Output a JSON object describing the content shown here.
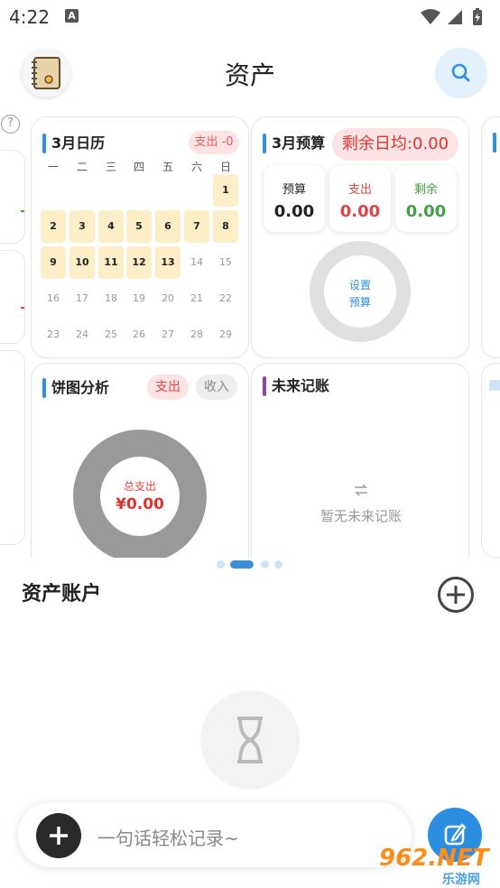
{
  "status": {
    "time": "4:22",
    "notif_icon": "A"
  },
  "header": {
    "title": "资产"
  },
  "calendar": {
    "title": "3月日历",
    "spend_badge": "支出 -0",
    "weekdays": [
      "一",
      "二",
      "三",
      "四",
      "五",
      "六",
      "日"
    ],
    "weeks": [
      [
        "",
        "",
        "",
        "",
        "",
        "",
        "1"
      ],
      [
        "2",
        "3",
        "4",
        "5",
        "6",
        "7",
        "8"
      ],
      [
        "9",
        "10",
        "11",
        "12",
        "13",
        "14",
        "15"
      ],
      [
        "16",
        "17",
        "18",
        "19",
        "20",
        "21",
        "22"
      ],
      [
        "23",
        "24",
        "25",
        "26",
        "27",
        "28",
        "29"
      ]
    ],
    "highlighted_days": [
      "1",
      "2",
      "3",
      "4",
      "5",
      "6",
      "7",
      "8",
      "9",
      "10",
      "11",
      "12",
      "13"
    ]
  },
  "budget": {
    "title": "3月预算",
    "daily_remaining": "剩余日均:0.00",
    "items": [
      {
        "label": "预算",
        "value": "0.00",
        "color": "#222222"
      },
      {
        "label": "支出",
        "value": "0.00",
        "color": "#e04444"
      },
      {
        "label": "剩余",
        "value": "0.00",
        "color": "#43a047"
      }
    ],
    "ring_line1": "设置",
    "ring_line2": "预算"
  },
  "pie": {
    "title": "饼图分析",
    "tab_expense": "支出",
    "tab_income": "收入",
    "center_label": "总支出",
    "center_value": "¥0.00"
  },
  "future": {
    "title": "未来记账",
    "empty_text": "暂无未来记账"
  },
  "assets": {
    "title": "资产账户"
  },
  "input": {
    "placeholder": "一句话轻松记录~"
  },
  "watermark": {
    "text": "962.NET",
    "sub": "乐游网"
  },
  "colors": {
    "accent": "#2f8fe3",
    "red": "#e04444",
    "green": "#43a047",
    "calendar_highlight": "#fcefc8"
  }
}
